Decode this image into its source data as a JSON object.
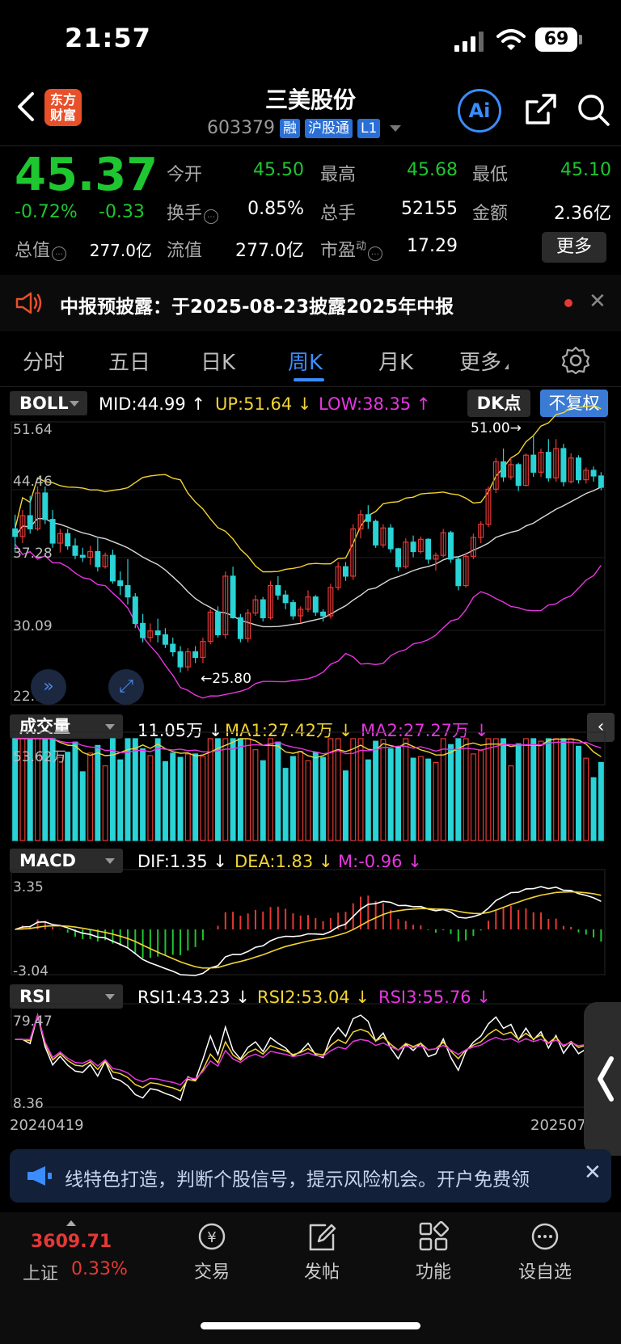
{
  "status": {
    "time": "21:57",
    "battery": "69"
  },
  "header": {
    "logo_line1": "东方",
    "logo_line2": "财富",
    "title": "三美股份",
    "code": "603379",
    "tags": [
      "融",
      "沪股通",
      "L1"
    ],
    "ai_label": "Ai"
  },
  "quote": {
    "price": "45.37",
    "change_pct": "-0.72%",
    "change": "-0.33",
    "fields": [
      {
        "label": "今开",
        "value": "45.50"
      },
      {
        "label": "最高",
        "value": "45.68"
      },
      {
        "label": "最低",
        "value": "45.10"
      },
      {
        "label": "换手",
        "value": "0.85%"
      },
      {
        "label": "总手",
        "value": "52155"
      },
      {
        "label": "金额",
        "value": "2.36亿"
      },
      {
        "label": "总值",
        "value": "277.0亿"
      },
      {
        "label": "流值",
        "value": "277.0亿"
      },
      {
        "label": "市盈",
        "sup": "动",
        "value": "17.29"
      }
    ],
    "more_label": "更多"
  },
  "notice": {
    "text": "中报预披露：于2025-08-23披露2025年中报"
  },
  "tabs": [
    "分时",
    "五日",
    "日K",
    "周K",
    "月K",
    "更多"
  ],
  "active_tab": "周K",
  "boll": {
    "name": "BOLL",
    "mid": "MID:44.99",
    "up": "UP:51.64",
    "low": "LOW:38.35",
    "dk": "DK点",
    "fq": "不复权",
    "axis": [
      "51.64",
      "44.46",
      "37.28",
      "30.09",
      "22.91"
    ],
    "hi_mark": "51.00",
    "lo_mark": "25.80"
  },
  "volume": {
    "name": "成交量",
    "cur": "11.05万",
    "ma1": "MA1:27.42万",
    "ma2": "MA2:27.27万",
    "axis_top": "53.62万"
  },
  "macd": {
    "name": "MACD",
    "dif": "DIF:1.35",
    "dea": "DEA:1.83",
    "m": "M:-0.96",
    "axis_top": "3.35",
    "axis_bottom": "-3.04"
  },
  "rsi": {
    "name": "RSI",
    "r1": "RSI1:43.23",
    "r2": "RSI2:53.04",
    "r3": "RSI3:55.76",
    "axis_top": "79.47",
    "axis_bottom": "8.36"
  },
  "dates": {
    "start": "20240419",
    "end": "202507"
  },
  "ad": {
    "text": "线特色打造，判断个股信号，提示风险机会。开户免费领"
  },
  "bottom": {
    "index_value": "3609.71",
    "index_name": "上证",
    "index_pct": "0.33%",
    "nav": [
      "交易",
      "发帖",
      "功能",
      "设自选"
    ]
  },
  "colors": {
    "up": "#e53935",
    "down": "#1ec630",
    "candle_down": "#29d3d6",
    "accent": "#3a8cff"
  },
  "chart_data": {
    "type": "candlestick",
    "candles": [
      [
        41,
        42.5,
        38.5,
        40.2
      ],
      [
        40.2,
        43,
        39.5,
        42.4
      ],
      [
        42.4,
        44.5,
        40.5,
        41
      ],
      [
        41,
        45.5,
        40.8,
        44.8
      ],
      [
        44.8,
        45.5,
        41.5,
        42
      ],
      [
        42,
        43,
        39,
        39.5
      ],
      [
        39.5,
        41,
        38.5,
        40.5
      ],
      [
        40.5,
        41,
        38.8,
        39.2
      ],
      [
        39.2,
        40,
        37.8,
        38.2
      ],
      [
        38.2,
        39,
        37.5,
        38
      ],
      [
        38,
        39.2,
        37.2,
        38.6
      ],
      [
        38.6,
        40,
        36.5,
        37
      ],
      [
        37,
        38.5,
        36.8,
        38.2
      ],
      [
        38.2,
        38.8,
        35.2,
        35.5
      ],
      [
        35.5,
        36.5,
        34,
        35
      ],
      [
        35,
        37.8,
        33,
        33.8
      ],
      [
        33.8,
        34.2,
        30.5,
        31
      ],
      [
        31,
        32,
        29,
        29.5
      ],
      [
        29.5,
        31,
        29,
        30.2
      ],
      [
        30.2,
        31.5,
        29,
        29.8
      ],
      [
        29.8,
        30.5,
        28.4,
        28.8
      ],
      [
        28.8,
        29.5,
        27.5,
        28
      ],
      [
        28,
        28.6,
        25.8,
        26.4
      ],
      [
        26.4,
        28.4,
        26,
        28
      ],
      [
        28,
        28.6,
        26.8,
        27.4
      ],
      [
        27.4,
        29.5,
        26.8,
        29.1
      ],
      [
        29.1,
        32.5,
        28.8,
        32.2
      ],
      [
        32.2,
        32.8,
        29.5,
        29.8
      ],
      [
        29.8,
        36.5,
        29.4,
        36
      ],
      [
        36,
        37,
        31.5,
        31.6
      ],
      [
        31.6,
        32,
        29,
        29.4
      ],
      [
        29.4,
        32.5,
        29,
        32.1
      ],
      [
        32.1,
        34,
        31.8,
        33.5
      ],
      [
        33.5,
        33.8,
        31.2,
        31.6
      ],
      [
        31.6,
        35.5,
        31.4,
        35
      ],
      [
        35,
        36,
        33.5,
        34
      ],
      [
        34,
        34.5,
        32.5,
        33.2
      ],
      [
        33.2,
        33.5,
        31.4,
        31.8
      ],
      [
        31.8,
        32.8,
        31,
        32.5
      ],
      [
        32.5,
        34.5,
        32.2,
        33.8
      ],
      [
        33.8,
        34,
        31.8,
        32.2
      ],
      [
        32.2,
        32.5,
        31.2,
        31.8
      ],
      [
        31.8,
        35.2,
        31.5,
        34.8
      ],
      [
        34.8,
        37.5,
        34.5,
        37
      ],
      [
        37,
        37.5,
        35.5,
        36
      ],
      [
        36,
        41.5,
        35.6,
        41
      ],
      [
        41,
        43,
        40,
        42.5
      ],
      [
        42.5,
        43.5,
        41,
        41.8
      ],
      [
        41.8,
        42,
        39,
        39.3
      ],
      [
        39.3,
        41.5,
        39,
        41.1
      ],
      [
        41.1,
        41.5,
        38.5,
        38.9
      ],
      [
        38.9,
        39,
        36.5,
        37
      ],
      [
        37,
        40,
        36.8,
        39.6
      ],
      [
        39.6,
        40.3,
        38,
        38.6
      ],
      [
        38.6,
        40.2,
        38.4,
        39.9
      ],
      [
        39.9,
        40,
        37.3,
        37.8
      ],
      [
        37.8,
        38.5,
        36.6,
        38.2
      ],
      [
        38.2,
        41,
        38,
        40.6
      ],
      [
        40.6,
        40.8,
        37.4,
        37.8
      ],
      [
        37.8,
        38,
        34.5,
        35
      ],
      [
        35,
        38.5,
        34.8,
        38.1
      ],
      [
        38.1,
        40.5,
        37.8,
        40.1
      ],
      [
        40.1,
        41.8,
        39.5,
        41.5
      ],
      [
        41.5,
        45.5,
        41.2,
        45.2
      ],
      [
        45.2,
        48.5,
        44.8,
        48.1
      ],
      [
        48.1,
        49.5,
        46,
        46.5
      ],
      [
        46.5,
        48.5,
        46.2,
        47.8
      ],
      [
        47.8,
        48,
        45,
        45.6
      ],
      [
        45.6,
        49,
        45.5,
        48.8
      ],
      [
        48.8,
        51,
        46.5,
        47
      ],
      [
        47,
        49.5,
        46.5,
        49.1
      ],
      [
        49.1,
        50.5,
        46,
        46.4
      ],
      [
        46.4,
        50.5,
        46,
        49.5
      ],
      [
        49.5,
        50,
        45.5,
        46
      ],
      [
        46,
        49,
        45.8,
        48.5
      ],
      [
        48.5,
        48.8,
        45.8,
        46.2
      ],
      [
        46.2,
        47.5,
        45.8,
        47.2
      ],
      [
        47.2,
        47.6,
        46,
        46.6
      ],
      [
        46.6,
        47,
        45.1,
        45.4
      ]
    ],
    "volume_axis_top": 53.62,
    "macd_range": [
      -3.04,
      3.35
    ],
    "rsi_range": [
      8.36,
      79.47
    ],
    "price_axis": [
      22.91,
      51.64
    ]
  }
}
